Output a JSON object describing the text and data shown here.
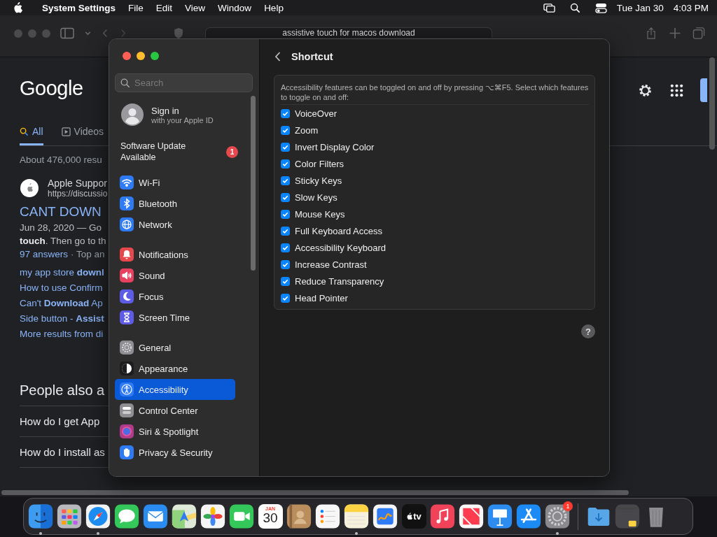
{
  "menubar": {
    "app_name": "System Settings",
    "menus": [
      "File",
      "Edit",
      "View",
      "Window",
      "Help"
    ],
    "date": "Tue Jan 30",
    "time": "4:03 PM"
  },
  "browser": {
    "address": "assistive touch for macos download",
    "google": {
      "logo": "Google",
      "tabs": [
        {
          "label": "All",
          "selected": true
        },
        {
          "label": "Videos",
          "selected": false
        }
      ],
      "result_count": "About 476,000 resu",
      "result": {
        "site": "Apple Suppor",
        "url": "https://discussio",
        "title": "CANT DOWN",
        "snippet": [
          "Jun 28, 2020 — Go",
          "**touch**. Then go to th"
        ],
        "answers": "97 answers",
        "answers_rest": "· Top an",
        "links": [
          "my app store **downl**",
          "How to use Confirm",
          "Can't **Download** Ap",
          "Side button - **Assist**",
          "More results from di"
        ]
      },
      "people_also_ask": {
        "heading": "People also a",
        "questions": [
          "How do I get App",
          "How do I install as"
        ]
      }
    }
  },
  "settings": {
    "sidebar": {
      "search": {
        "placeholder": "Search"
      },
      "account": {
        "title": "Sign in",
        "subtitle": "with your Apple ID"
      },
      "update": {
        "label": "Software Update Available",
        "badge": "1"
      },
      "groups": [
        [
          {
            "label": "Wi-Fi",
            "kind": "wifi",
            "color": "#2f7bf5",
            "selected": false
          },
          {
            "label": "Bluetooth",
            "kind": "bluetooth",
            "color": "#2f7bf5",
            "selected": false
          },
          {
            "label": "Network",
            "kind": "network",
            "color": "#2f7bf5",
            "selected": false
          }
        ],
        [
          {
            "label": "Notifications",
            "kind": "notifications",
            "color": "#e5484d",
            "selected": false
          },
          {
            "label": "Sound",
            "kind": "sound",
            "color": "#e8405f",
            "selected": false
          },
          {
            "label": "Focus",
            "kind": "focus",
            "color": "#5e5ce6",
            "selected": false
          },
          {
            "label": "Screen Time",
            "kind": "screen_time",
            "color": "#5e5ce6",
            "selected": false
          }
        ],
        [
          {
            "label": "General",
            "kind": "general",
            "color": "#8e8e93",
            "selected": false
          },
          {
            "label": "Appearance",
            "kind": "appearance",
            "color": "#1c1c1e",
            "selected": false
          },
          {
            "label": "Accessibility",
            "kind": "accessibility",
            "color": "#2f7bf5",
            "selected": true
          },
          {
            "label": "Control Center",
            "kind": "control_center",
            "color": "#8e8e93",
            "selected": false
          },
          {
            "label": "Siri & Spotlight",
            "kind": "siri",
            "color": "#b03a8c",
            "selected": false
          },
          {
            "label": "Privacy & Security",
            "kind": "privacy",
            "color": "#2f7bf5",
            "selected": false
          }
        ]
      ]
    },
    "page": {
      "title": "Shortcut",
      "description": "Accessibility features can be toggled on and off by pressing ⌥⌘F5. Select which features to toggle on and off:",
      "features": [
        {
          "label": "VoiceOver",
          "checked": true
        },
        {
          "label": "Zoom",
          "checked": true
        },
        {
          "label": "Invert Display Color",
          "checked": true
        },
        {
          "label": "Color Filters",
          "checked": true
        },
        {
          "label": "Sticky Keys",
          "checked": true
        },
        {
          "label": "Slow Keys",
          "checked": true
        },
        {
          "label": "Mouse Keys",
          "checked": true
        },
        {
          "label": "Full Keyboard Access",
          "checked": true
        },
        {
          "label": "Accessibility Keyboard",
          "checked": true
        },
        {
          "label": "Increase Contrast",
          "checked": true
        },
        {
          "label": "Reduce Transparency",
          "checked": true
        },
        {
          "label": "Head Pointer",
          "checked": true
        }
      ],
      "help": "?"
    }
  },
  "dock": [
    {
      "kind": "finder",
      "color": "#3d9bf0",
      "running": true
    },
    {
      "kind": "launchpad",
      "color": "#b8b8be",
      "running": false
    },
    {
      "kind": "safari",
      "color": "#f2f2f2",
      "running": true
    },
    {
      "kind": "messages",
      "color": "#34c759",
      "running": false
    },
    {
      "kind": "mail",
      "color": "#2a8cf0",
      "running": false
    },
    {
      "kind": "maps",
      "color": "#dfe9d8",
      "running": false
    },
    {
      "kind": "photos",
      "color": "#f5f5f5",
      "running": false
    },
    {
      "kind": "facetime",
      "color": "#34c759",
      "running": false
    },
    {
      "kind": "calendar",
      "color": "#ffffff",
      "running": false,
      "month": "JAN",
      "day": "30"
    },
    {
      "kind": "contacts",
      "color": "#b98d5c",
      "running": false
    },
    {
      "kind": "reminders",
      "color": "#f7f7f7",
      "running": false
    },
    {
      "kind": "notes",
      "color": "#f6f1dc",
      "running": true
    },
    {
      "kind": "freeform",
      "color": "#f5f5f5",
      "running": false
    },
    {
      "kind": "tv",
      "color": "#111111",
      "running": false,
      "label": "tv"
    },
    {
      "kind": "music",
      "color": "#f0435a",
      "running": false
    },
    {
      "kind": "news",
      "color": "#f7f7f7",
      "running": false
    },
    {
      "kind": "keynote",
      "color": "#2d8cf0",
      "running": false
    },
    {
      "kind": "appstore",
      "color": "#1d8bf5",
      "running": false
    },
    {
      "kind": "settings",
      "color": "#8a8a8e",
      "running": true,
      "badge": "1"
    },
    {
      "kind": "folder",
      "color": "#56a6e8",
      "running": false,
      "separator": true
    },
    {
      "kind": "window",
      "color": "#48484c",
      "running": false
    },
    {
      "kind": "trash",
      "color": "#8d8d92",
      "running": false
    }
  ]
}
